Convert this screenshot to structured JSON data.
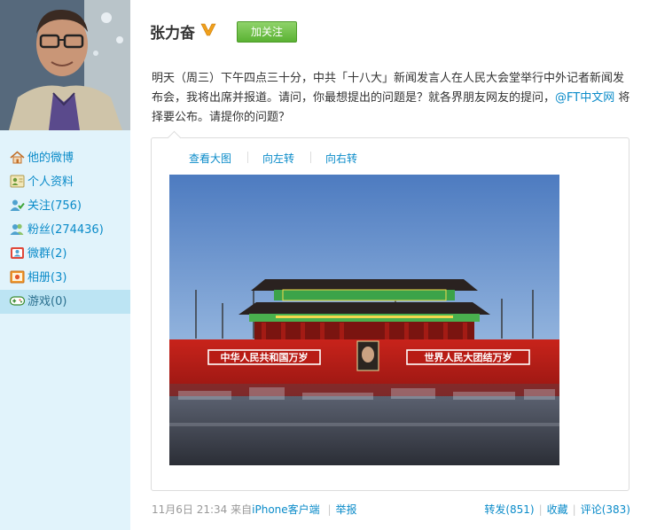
{
  "profile": {
    "name": "张力奋",
    "follow_label": "加关注"
  },
  "sidebar": {
    "items": [
      {
        "label": "他的微博",
        "icon": "home-icon",
        "active": false
      },
      {
        "label": "个人资料",
        "icon": "profile-icon",
        "active": false
      },
      {
        "label": "关注(756)",
        "icon": "following-icon",
        "active": false
      },
      {
        "label": "粉丝(274436)",
        "icon": "fans-icon",
        "active": false
      },
      {
        "label": "微群(2)",
        "icon": "group-icon",
        "active": false
      },
      {
        "label": "相册(3)",
        "icon": "album-icon",
        "active": false
      },
      {
        "label": "游戏(0)",
        "icon": "game-icon",
        "active": true
      }
    ]
  },
  "post": {
    "text_part1": "明天（周三）下午四点三十分，中共「十八大」新闻发言人在人民大会堂举行中外记者新闻发布会，我将出席并报道。请问，你最想提出的问题是？就各界朋友网友的提问，",
    "mention": "@FT中文网",
    "text_part2": " 将择要公布。请提你的问题？",
    "media_actions": {
      "view_large": "查看大图",
      "rotate_left": "向左转",
      "rotate_right": "向右转"
    },
    "photo_banner_left": "中华人民共和国万岁",
    "photo_banner_right": "世界人民大团结万岁",
    "time": "11月6日 21:34",
    "source_prefix": "来自",
    "source": "iPhone客户端",
    "report": "举报",
    "repost": "转发(851)",
    "favorite": "收藏",
    "comment": "评论(383)"
  }
}
